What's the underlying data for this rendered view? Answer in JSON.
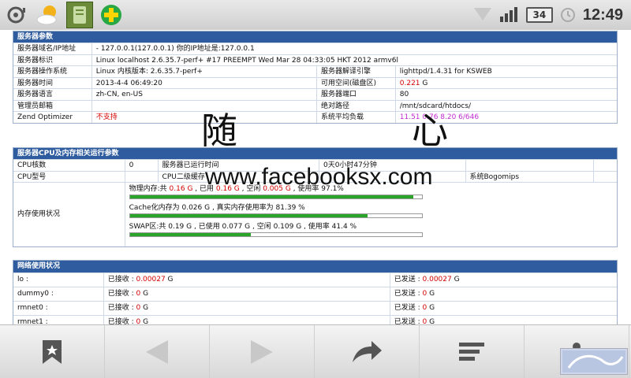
{
  "statusbar": {
    "battery": "34",
    "time": "12:49"
  },
  "server_params": {
    "title": "服务器参数",
    "rows": [
      {
        "label": "服务器域名/IP地址",
        "value": "- 127.0.0.1(127.0.0.1)  你的IP地址是:127.0.0.1"
      },
      {
        "label": "服务器标识",
        "value": "Linux localhost 2.6.35.7-perf+ #17 PREEMPT Wed Mar 28 04:33:05 HKT 2012 armv6l"
      },
      {
        "label": "服务器操作系统",
        "value": "Linux  内核版本: 2.6.35.7-perf+",
        "label2": "服务器解译引擎",
        "value2": "lighttpd/1.4.31 for KSWEB"
      },
      {
        "label": "服务器时间",
        "value": "2013-4-4 06:49:20",
        "label2": "可用空间(磁盘区)",
        "value2_num": "0.221",
        "value2_unit": " G"
      },
      {
        "label": "服务器语言",
        "value": "zh-CN, en-US",
        "label2": "服务器端口",
        "value2": "80"
      },
      {
        "label": "管理员邮箱",
        "value": "",
        "label2": "绝对路径",
        "value2": "/mnt/sdcard/htdocs/"
      },
      {
        "label": "Zend Optimizer",
        "value": "不支持",
        "label2": "系统平均负载",
        "value2": "11.51 0.76 8.20 6/646"
      }
    ]
  },
  "cpu_section": {
    "title": "服务器CPU及内存相关运行参数",
    "cpu_count_label": "CPU核数",
    "cpu_count_value": "0",
    "uptime_label": "服务器已运行时间",
    "uptime_value": "0天0小时47分钟",
    "cpu_model_label": "CPU型号",
    "cpu_cache_label": "CPU二级缓存",
    "bogomips_label": "系统Bogomips",
    "mem_label": "内存使用状况",
    "mem_physical": {
      "prefix": "物理内存:共 ",
      "total": "0.16 G",
      "used_prefix": " , 已用 ",
      "used": "0.16 G",
      "free_prefix": " , 空闲 ",
      "free": "0.005 G",
      "rate_prefix": " , 使用率 ",
      "rate": "97.1%",
      "fill": 0.971
    },
    "mem_cache": {
      "text": "Cache化内存为 0.026 G ,  真实内存使用率为 81.39 %",
      "fill": 0.8139
    },
    "mem_swap": {
      "text": "SWAP区:共 0.19 G ,  已使用 0.077 G ,  空闲 0.109 G ,  使用率 41.4 %",
      "fill": 0.414
    }
  },
  "network": {
    "title": "网络使用状况",
    "rows": [
      {
        "iface": "lo :",
        "rx_prefix": "已接收 : ",
        "rx": "0.00027",
        "rx_unit": " G",
        "tx_prefix": "已发送 : ",
        "tx": "0.00027",
        "tx_unit": " G"
      },
      {
        "iface": "dummy0 :",
        "rx_prefix": "已接收 : ",
        "rx": "0",
        "rx_unit": " G",
        "tx_prefix": "已发送 : ",
        "tx": "0",
        "tx_unit": " G"
      },
      {
        "iface": "rmnet0 :",
        "rx_prefix": "已接收 : ",
        "rx": "0",
        "rx_unit": " G",
        "tx_prefix": "已发送 : ",
        "tx": "0",
        "tx_unit": " G"
      },
      {
        "iface": "rmnet1 :",
        "rx_prefix": "已接收 : ",
        "rx": "0",
        "rx_unit": " G",
        "tx_prefix": "已发送 : ",
        "tx": "0",
        "tx_unit": " G"
      }
    ]
  },
  "watermark": {
    "char1": "随",
    "char2": "心",
    "url": "www.facebooksx.com"
  },
  "toolbar": {
    "icons": [
      "bookmark-icon",
      "back-icon",
      "forward-icon",
      "share-icon",
      "menu-icon",
      "extension-icon"
    ]
  },
  "colors": {
    "header_blue": "#2f5c9e",
    "bar_green": "#2aa52a",
    "value_red": "#d40000",
    "value_magenta": "#c02bd0"
  }
}
